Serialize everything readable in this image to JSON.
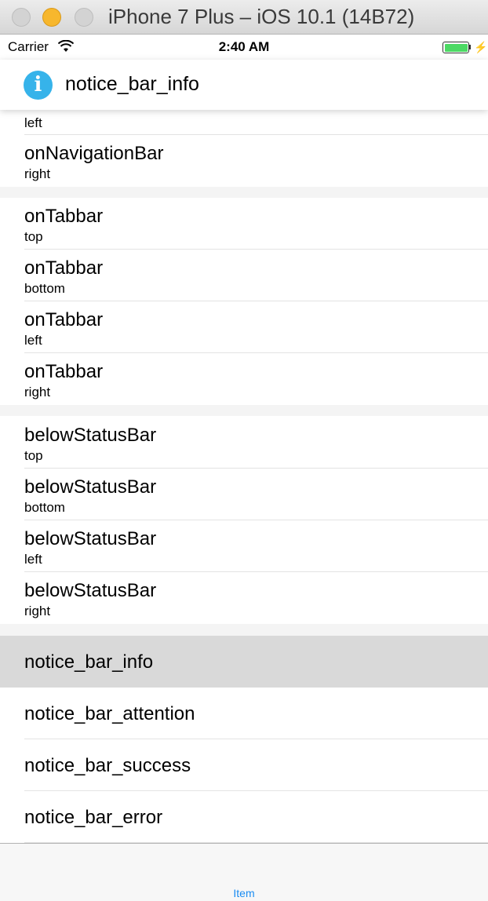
{
  "window": {
    "title": "iPhone 7 Plus – iOS 10.1 (14B72)"
  },
  "status_bar": {
    "carrier": "Carrier",
    "time": "2:40 AM",
    "battery_color": "#4cd964"
  },
  "notice_bar": {
    "text": "notice_bar_info",
    "icon": "info-icon",
    "icon_glyph": "i",
    "color": "#36b3ea"
  },
  "list": {
    "partial_row_subtitle": "left",
    "nav_right": {
      "title": "onNavigationBar",
      "subtitle": "right"
    },
    "tabbar_rows": [
      {
        "title": "onTabbar",
        "subtitle": "top"
      },
      {
        "title": "onTabbar",
        "subtitle": "bottom"
      },
      {
        "title": "onTabbar",
        "subtitle": "left"
      },
      {
        "title": "onTabbar",
        "subtitle": "right"
      }
    ],
    "status_rows": [
      {
        "title": "belowStatusBar",
        "subtitle": "top"
      },
      {
        "title": "belowStatusBar",
        "subtitle": "bottom"
      },
      {
        "title": "belowStatusBar",
        "subtitle": "left"
      },
      {
        "title": "belowStatusBar",
        "subtitle": "right"
      }
    ],
    "style_rows": [
      {
        "title": "notice_bar_info",
        "selected": true
      },
      {
        "title": "notice_bar_attention",
        "selected": false
      },
      {
        "title": "notice_bar_success",
        "selected": false
      },
      {
        "title": "notice_bar_error",
        "selected": false
      }
    ]
  },
  "tab_bar": {
    "item_label": "Item",
    "accent": "#1a8cf2"
  }
}
